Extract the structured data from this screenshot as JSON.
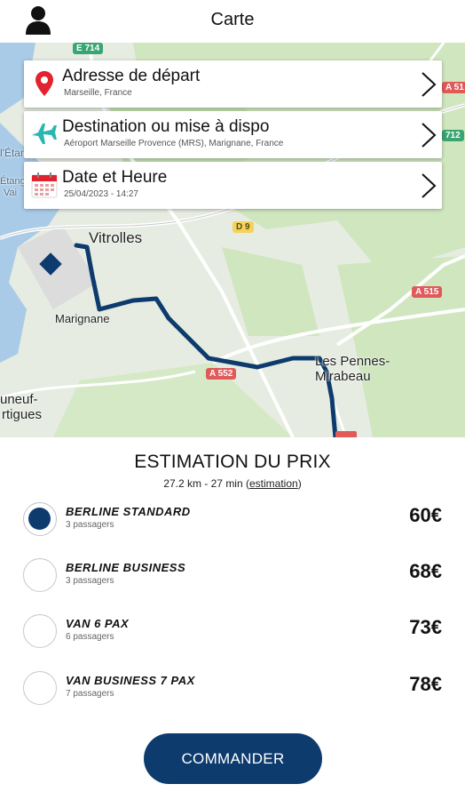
{
  "header": {
    "title": "Carte",
    "user_icon": "user-icon"
  },
  "map": {
    "labels": {
      "vitrolles": "Vitrolles",
      "marignane": "Marignane",
      "les_pennes": "Les Pennes-",
      "mirabeau": "Mirabeau",
      "uneuf": "uneuf-",
      "rtigues": "rtigues",
      "etang": "l'Étang",
      "etang2": "Étang",
      "vai": "Vai"
    },
    "roads": {
      "e714": "E 714",
      "a51": "A 51",
      "r712": "712",
      "d9": "D 9",
      "a515": "A 515",
      "a552": "A 552"
    },
    "colors": {
      "route": "#0d3b6e",
      "water": "#a9cbe8",
      "land": "#e6ece1",
      "green": "#c9e3b8"
    }
  },
  "cards": {
    "departure": {
      "label": "Adresse de départ",
      "value": "Marseille, France",
      "icon": "map-pin-icon"
    },
    "destination": {
      "label": "Destination ou mise à dispo",
      "value": "Aéroport Marseille Provence (MRS), Marignane, France",
      "icon": "airplane-icon"
    },
    "datetime": {
      "label": "Date et Heure",
      "value": "25/04/2023 - 14:27",
      "icon": "calendar-icon"
    }
  },
  "estimate": {
    "title": "ESTIMATION DU PRIX",
    "distance_time": "27.2 km - 27 min",
    "link": "estimation"
  },
  "options": [
    {
      "name": "BERLINE STANDARD",
      "pax": "3 passagers",
      "price": "60€",
      "selected": true
    },
    {
      "name": "BERLINE BUSINESS",
      "pax": "3 passagers",
      "price": "68€",
      "selected": false
    },
    {
      "name": "VAN 6 PAX",
      "pax": "6 passagers",
      "price": "73€",
      "selected": false
    },
    {
      "name": "VAN BUSINESS 7 PAX",
      "pax": "7 passagers",
      "price": "78€",
      "selected": false
    }
  ],
  "order_button": "COMMANDER"
}
